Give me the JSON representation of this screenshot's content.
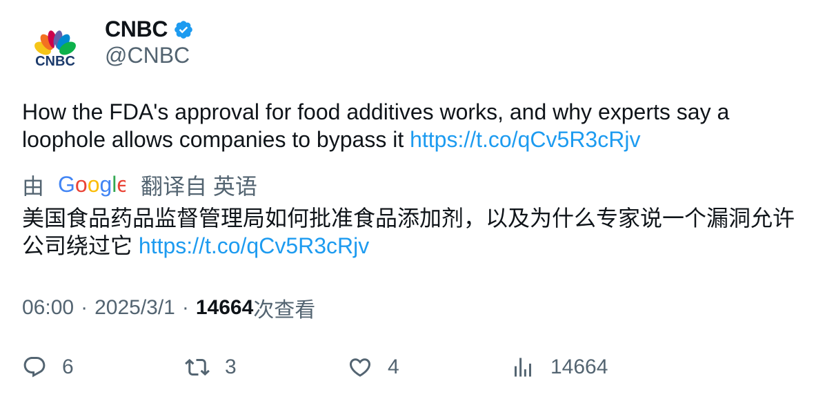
{
  "author": {
    "display_name": "CNBC",
    "handle": "@CNBC",
    "avatar_logo_text": "CNBC",
    "verified": true
  },
  "tweet": {
    "text": "How the FDA's approval for food additives works, and why experts say a loophole allows companies to bypass it ",
    "link": "https://t.co/qCv5R3cRjv"
  },
  "translation": {
    "by_label": "由",
    "provider": "Google",
    "from_label": "翻译自 英语",
    "text": "美国食品药品监督管理局如何批准食品添加剂，以及为什么专家说一个漏洞允许公司绕过它 ",
    "link": "https://t.co/qCv5R3cRjv"
  },
  "meta": {
    "time": "06:00",
    "separator": "·",
    "date": "2025/3/1",
    "views": "14664",
    "views_label": "次查看"
  },
  "actions": {
    "replies": "6",
    "retweets": "3",
    "likes": "4",
    "views": "14664"
  },
  "colors": {
    "link": "#1d9bf0",
    "secondary": "#536471",
    "verified": "#1d9bf0",
    "text": "#0f1419"
  },
  "icons": [
    "verified-badge-icon",
    "reply-icon",
    "retweet-icon",
    "like-icon",
    "views-icon"
  ]
}
